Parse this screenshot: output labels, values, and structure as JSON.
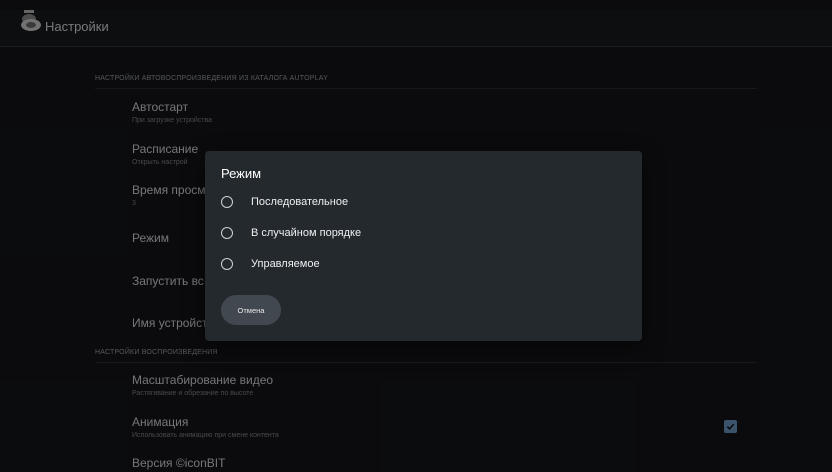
{
  "app": {
    "title": "Настройки",
    "logo_icon": "tv-logo-icon"
  },
  "sections": [
    {
      "header": "НАСТРОЙКИ АВТОВОСПРОИЗВЕДЕНИЯ ИЗ КАТАЛОГА AUTOPLAY"
    },
    {
      "header": "НАСТРОЙКИ ВОСПРОИЗВЕДЕНИЯ"
    }
  ],
  "prefs": [
    {
      "title": "Автостарт",
      "subtitle": "При загрузке устройства"
    },
    {
      "title": "Расписание",
      "subtitle": "Открыть настрой"
    },
    {
      "title": "Время просм",
      "subtitle": "3"
    },
    {
      "title": "Режим"
    },
    {
      "title": "Запустить вс"
    },
    {
      "title": "Имя устройст"
    },
    {
      "title": "Масштабирование видео",
      "subtitle": "Растягивание и обрезание по высоте"
    },
    {
      "title": "Анимация",
      "subtitle": "Использовать анимацию при смене контента",
      "checked": true
    },
    {
      "title": "Версия ©iconBIT"
    }
  ],
  "dialog": {
    "title": "Режим",
    "options": [
      "Последовательное",
      "В случайном порядке",
      "Управляемое"
    ],
    "cancel_label": "Отмена"
  },
  "colors": {
    "background": "#141518",
    "dialog": "#24292e",
    "accent": "#6e9ac4"
  }
}
